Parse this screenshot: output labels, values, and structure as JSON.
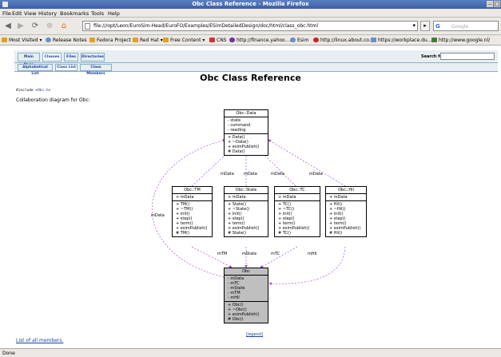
{
  "window": {
    "title": "Obc Class Reference - Mozilla Firefox"
  },
  "menu": [
    "File",
    "Edit",
    "View",
    "History",
    "Bookmarks",
    "Tools",
    "Help"
  ],
  "nav": {
    "url": "file:///opt/Leon/EuroSim-Head/EuroFO/Examples/ESimDetailedDesign/doc/html/class_obc.html",
    "search_placeholder": "Google",
    "search_engine": "G"
  },
  "bookmarks": [
    "Most Visited",
    "Release Notes",
    "Fedora Project",
    "Red Hat",
    "Free Content",
    "CNS",
    "http://finance.yahoo....",
    "Esim",
    "http://linux.about.co...",
    "https://workplace.du...",
    "http://www.google.nl/"
  ],
  "doc": {
    "tabs_main": [
      "Main Page",
      "Classes",
      "Files",
      "Directories"
    ],
    "tabs_sub": [
      "Alphabetical List",
      "Class List",
      "Class Members"
    ],
    "search_label": "Search for",
    "title": "Obc Class Reference",
    "include_prefix": "#include <",
    "include_file": "Obc.h",
    "include_suffix": ">",
    "collab_text": "Collaboration diagram for Obc:",
    "legend": "[legend]",
    "all_members": "List of all members."
  },
  "diagram": {
    "data": {
      "name": "Obc::Data",
      "attrs": [
        "- state",
        "- command",
        "- reading"
      ],
      "methods": [
        "+ Data()",
        "+ ~Data()",
        "+ esimPublish()",
        "# Data()"
      ]
    },
    "tm": {
      "name": "Obc::TM",
      "attrs": [
        "+ mData"
      ],
      "methods": [
        "+ TM()",
        "+ ~TM()",
        "+ init()",
        "+ step()",
        "+ term()",
        "+ esimPublish()",
        "# TM()"
      ]
    },
    "state": {
      "name": "Obc::State",
      "attrs": [
        "+ mData"
      ],
      "methods": [
        "+ State()",
        "+ ~State()",
        "+ init()",
        "+ step()",
        "+ term()",
        "+ esimPublish()",
        "# State()"
      ]
    },
    "tc": {
      "name": "Obc::TC",
      "attrs": [
        "+ mData"
      ],
      "methods": [
        "+ TC()",
        "+ ~TC()",
        "+ init()",
        "+ step()",
        "+ term()",
        "+ esimPublish()",
        "# TC()"
      ]
    },
    "hil": {
      "name": "Obc::Hil",
      "attrs": [
        "+ mData"
      ],
      "methods": [
        "+ Hil()",
        "+ ~Hil()",
        "+ init()",
        "+ step()",
        "+ term()",
        "+ esimPublish()",
        "# Hil()"
      ]
    },
    "obc": {
      "name": "Obc",
      "attrs": [
        "- mData",
        "- mTC",
        "- mState",
        "- mTM",
        "- mHil"
      ],
      "methods": [
        "+ Obc()",
        "+ ~Obc()",
        "+ esimPublish()",
        "# Obc()"
      ]
    },
    "edge_labels": [
      "mData",
      "mData",
      "mData",
      "mData",
      "mData",
      "mTM",
      "mState",
      "mTC",
      "mHil"
    ]
  },
  "status": "Done",
  "colors": {
    "edge": "#9a32cd",
    "link": "#1a419d"
  }
}
